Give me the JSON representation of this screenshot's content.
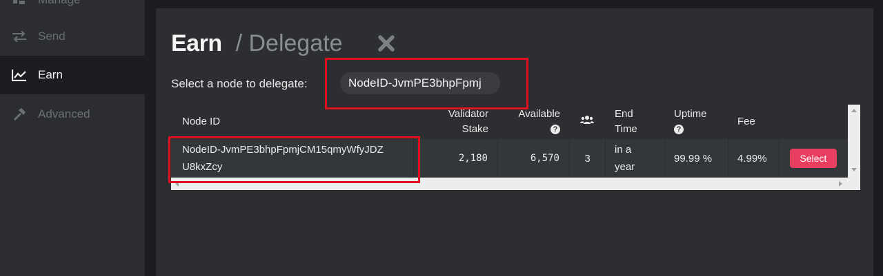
{
  "sidebar": {
    "items": [
      {
        "label": "Manage",
        "icon": "manage-icon"
      },
      {
        "label": "Send",
        "icon": "swap-arrows-icon"
      },
      {
        "label": "Earn",
        "icon": "chart-line-icon",
        "active": true
      },
      {
        "label": "Advanced",
        "icon": "hammer-icon"
      }
    ]
  },
  "header": {
    "title": "Earn",
    "subtitle": "/ Delegate",
    "close_icon": "close-icon"
  },
  "node_select": {
    "label": "Select a node to delegate:",
    "search_value": "NodeID-JvmPE3bhpFpmj"
  },
  "table": {
    "columns": {
      "node_id": "Node ID",
      "validator_stake_1": "Validator",
      "validator_stake_2": "Stake",
      "available": "Available",
      "delegators_icon": "users-icon",
      "end_time_1": "End",
      "end_time_2": "Time",
      "uptime": "Uptime",
      "fee": "Fee"
    },
    "help_glyph": "?",
    "rows": [
      {
        "node_id_line1": "NodeID-JvmPE3bhpFpmjCM15qmyWfyJDZ",
        "node_id_line2": "U8kxZcy",
        "validator_stake": "2,180",
        "available": "6,570",
        "delegators": "3",
        "end_time_line1": "in a",
        "end_time_line2": "year",
        "uptime": "99.99 %",
        "fee": "4.99%",
        "action": "Select"
      }
    ]
  },
  "colors": {
    "accent": "#e83e5f",
    "highlight_box": "#e0111f",
    "sidebar_bg": "#2b2d30",
    "panel_bg": "#2c2e31"
  }
}
